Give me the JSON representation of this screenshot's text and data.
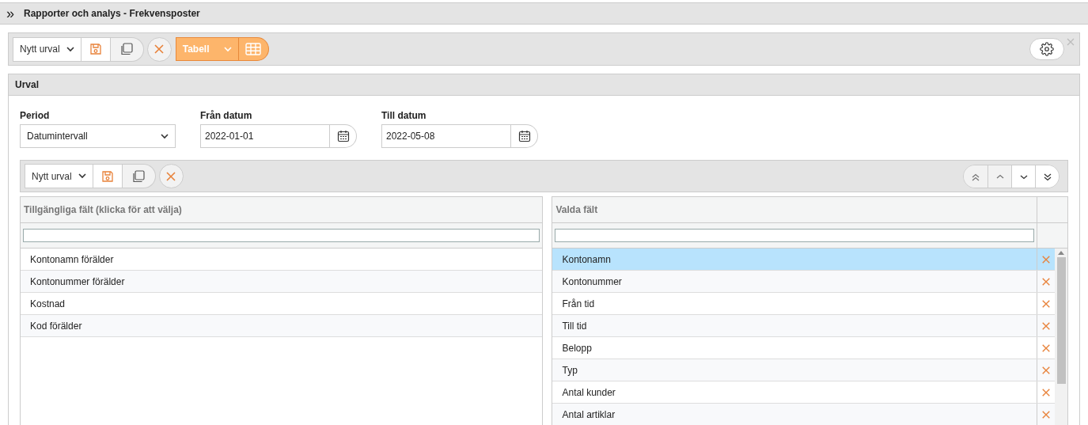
{
  "header": {
    "expand_icon_text": "»",
    "title": "Rapporter och analys - Frekvensposter"
  },
  "toolbar": {
    "selection": "Nytt urval",
    "view": "Tabell"
  },
  "panel": {
    "title": "Urval",
    "fields": [
      {
        "kind": "select",
        "label": "Period",
        "value": "Datumintervall"
      },
      {
        "kind": "date",
        "label": "Från datum",
        "value": "2022-01-01"
      },
      {
        "kind": "date",
        "label": "Till datum",
        "value": "2022-05-08"
      }
    ],
    "inner_toolbar": {
      "selection": "Nytt urval"
    },
    "available": {
      "header": "Tillgängliga fält (klicka för att välja)",
      "items": [
        "Kontonamn förälder",
        "Kontonummer förälder",
        "Kostnad",
        "Kod förälder"
      ]
    },
    "chosen": {
      "header": "Valda fält",
      "items": [
        {
          "label": "Kontonamn",
          "selected": true
        },
        {
          "label": "Kontonummer",
          "selected": false
        },
        {
          "label": "Från tid",
          "selected": false
        },
        {
          "label": "Till tid",
          "selected": false
        },
        {
          "label": "Belopp",
          "selected": false
        },
        {
          "label": "Typ",
          "selected": false
        },
        {
          "label": "Antal kunder",
          "selected": false
        },
        {
          "label": "Antal artiklar",
          "selected": false
        }
      ]
    }
  }
}
